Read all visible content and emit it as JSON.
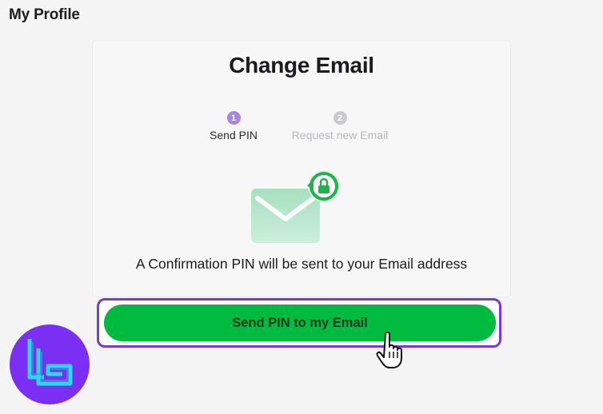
{
  "page": {
    "title": "My Profile"
  },
  "card": {
    "title": "Change Email",
    "steps": [
      {
        "number": "1",
        "label": "Send PIN",
        "state": "active"
      },
      {
        "number": "2",
        "label": "Request new Email",
        "state": "inactive"
      }
    ],
    "illustration_icon": "envelope-with-lock-icon",
    "info_text": "A Confirmation PIN will be sent to your Email address",
    "primary_button": {
      "label": "Send PIN to my Email"
    }
  },
  "colors": {
    "accent_purple": "#7a3ad6",
    "button_green": "#00bb3f",
    "step_active": "#a784e6",
    "step_inactive": "#c9c9ce",
    "logo_bg": "#7b2ff2",
    "logo_stroke": "#2fd6f2"
  },
  "overlay": {
    "cursor_icon": "hand-pointer-icon",
    "logo_icon": "brand-logo-icon"
  }
}
